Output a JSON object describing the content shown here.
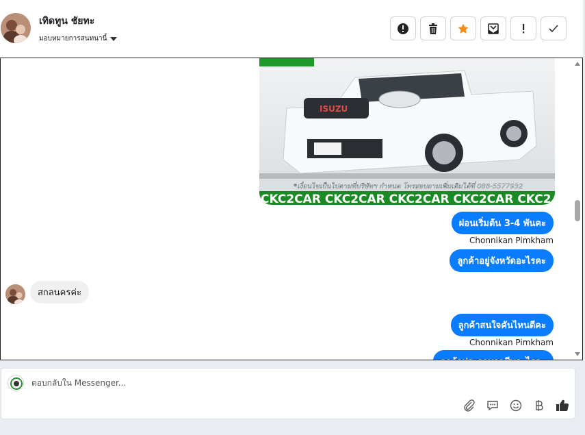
{
  "header": {
    "contact_name": "เทิดทูน ชัยทะ",
    "assign_label": "มอบหมายการสนทนานี้"
  },
  "toolbar": {
    "buttons": [
      {
        "name": "spam-icon"
      },
      {
        "name": "trash-icon"
      },
      {
        "name": "star-icon",
        "color": "#f28c18"
      },
      {
        "name": "mark-unread-icon"
      },
      {
        "name": "follow-up-icon"
      },
      {
        "name": "done-icon"
      }
    ]
  },
  "chat": {
    "image_banner_text": "CKC2CAR CKC2CAR CKC2CAR CKC2CAR CKC2",
    "image_caption": "*เงื่อนไขเป็นไปตามที่บริษัทฯ กำหนด โทรสอบถามเพิ่มเติมได้ที่ 088-5577932",
    "image_brand": "ISUZU",
    "messages": [
      {
        "dir": "out",
        "text": "ผ่อนเริ่มต้น 3-4 พันคะ",
        "sender": "Chonnikan Pimkham"
      },
      {
        "dir": "out",
        "text": "ลูกค้าอยู่จังหวัดอะไรคะ"
      },
      {
        "dir": "in",
        "text": "สกลนครค่ะ"
      },
      {
        "dir": "out",
        "text": "ลูกค้าสนใจคันไหนดีคะ",
        "sender": "Chonnikan Pimkham"
      },
      {
        "dir": "out",
        "text": "ลูกค้าประกอบอาชีพอะไรคะ"
      }
    ]
  },
  "composer": {
    "placeholder": "ตอบกลับใน Messenger...",
    "actions": [
      "attach-icon",
      "saved-reply-icon",
      "emoji-icon",
      "baht-icon",
      "like-icon"
    ]
  },
  "colors": {
    "accent": "#0a7cff",
    "incoming_bubble": "#f0f0f0",
    "star": "#f28c18"
  }
}
